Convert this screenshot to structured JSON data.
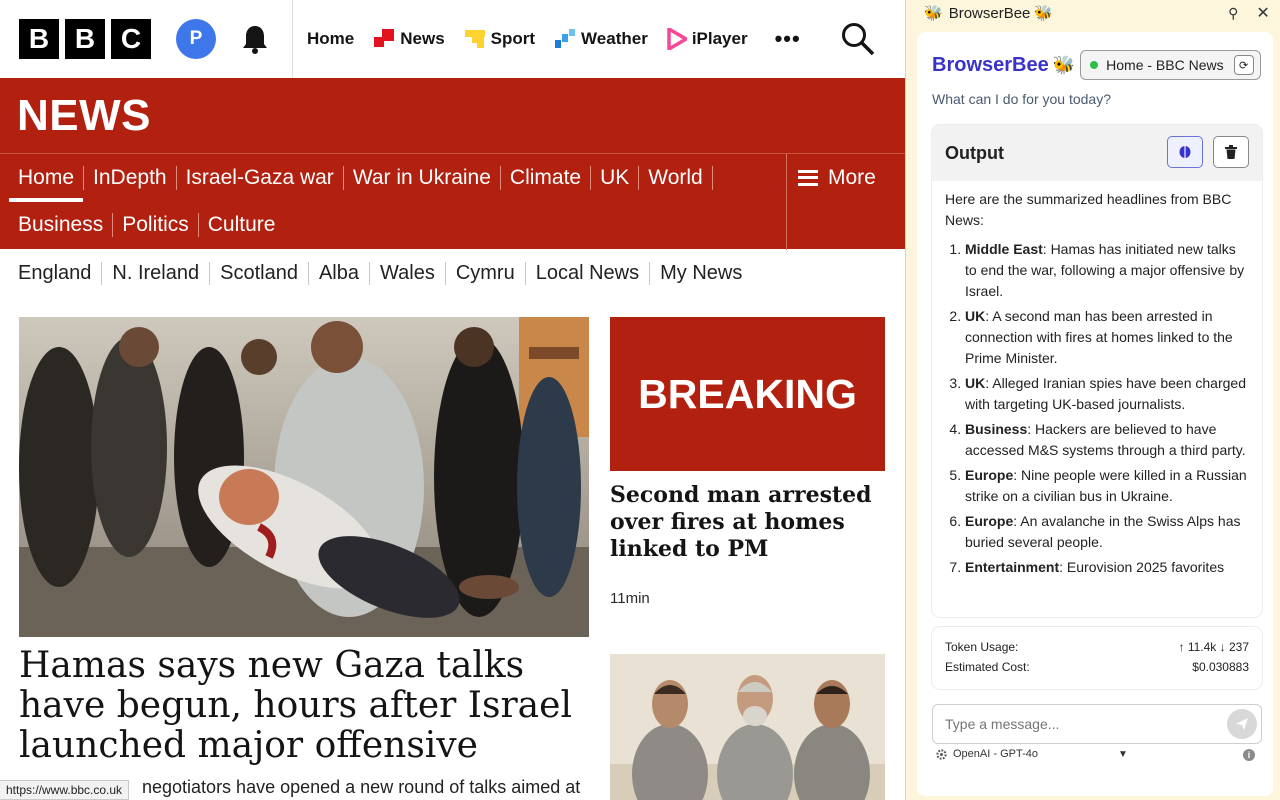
{
  "bbc": {
    "logo_letters": [
      "B",
      "B",
      "C"
    ],
    "avatar_letter": "P",
    "global_nav": [
      {
        "label": "Home",
        "icon": "none"
      },
      {
        "label": "News",
        "icon": "news-icon"
      },
      {
        "label": "Sport",
        "icon": "sport-icon"
      },
      {
        "label": "Weather",
        "icon": "weather-icon"
      },
      {
        "label": "iPlayer",
        "icon": "iplayer-icon"
      }
    ],
    "more_dots": "•••",
    "banner_title": "NEWS",
    "section_nav_row1": [
      "Home",
      "InDepth",
      "Israel-Gaza war",
      "War in Ukraine",
      "Climate",
      "UK",
      "World"
    ],
    "section_nav_row2": [
      "Business",
      "Politics",
      "Culture"
    ],
    "more_label": "More",
    "regions": [
      "England",
      "N. Ireland",
      "Scotland",
      "Alba",
      "Wales",
      "Cymru",
      "Local News",
      "My News"
    ],
    "main_headline": "Hamas says new Gaza talks have begun, hours after Israel launched major offensive",
    "main_summary": "negotiators have opened a new round of talks aimed at",
    "status_url": "https://www.bbc.co.uk",
    "breaking_label": "BREAKING",
    "side_headline": "Second man arrested over fires at homes linked to PM",
    "side_time": "11min",
    "brand_red": "#b2200f"
  },
  "extension": {
    "window_title": "BrowserBee",
    "title_emoji": "🐝",
    "brand": "BrowserBee",
    "current_tab": "Home - BBC News",
    "greeting": "What can I do for you today?",
    "output_title": "Output",
    "intro": "Here are the summarized headlines from BBC News:",
    "headlines": [
      {
        "tag": "Middle East",
        "text": ": Hamas has initiated new talks to end the war, following a major offensive by Israel."
      },
      {
        "tag": "UK",
        "text": ": A second man has been arrested in connection with fires at homes linked to the Prime Minister."
      },
      {
        "tag": "UK",
        "text": ": Alleged Iranian spies have been charged with targeting UK-based journalists."
      },
      {
        "tag": "Business",
        "text": ": Hackers are believed to have accessed M&S systems through a third party."
      },
      {
        "tag": "Europe",
        "text": ": Nine people were killed in a Russian strike on a civilian bus in Ukraine."
      },
      {
        "tag": "Europe",
        "text": ": An avalanche in the Swiss Alps has buried several people."
      },
      {
        "tag": "Entertainment",
        "text": ": Eurovision 2025 favorites"
      }
    ],
    "token_label": "Token Usage:",
    "token_value": "↑ 11.4k ↓ 237",
    "cost_label": "Estimated Cost:",
    "cost_value": "$0.030883",
    "message_placeholder": "Type a message...",
    "model": "OpenAI - GPT-4o",
    "accent": "#3a33c9",
    "panel_bg": "#fdf6dc"
  }
}
